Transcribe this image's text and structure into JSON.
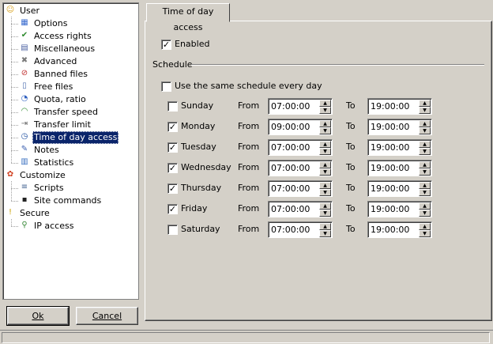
{
  "tree": {
    "items": [
      {
        "label": "User",
        "icon": "user-icon",
        "level": 0
      },
      {
        "label": "Options",
        "icon": "options-icon",
        "level": 1
      },
      {
        "label": "Access rights",
        "icon": "access-rights-icon",
        "level": 1
      },
      {
        "label": "Miscellaneous",
        "icon": "miscellaneous-icon",
        "level": 1
      },
      {
        "label": "Advanced",
        "icon": "tools-icon",
        "level": 1
      },
      {
        "label": "Banned files",
        "icon": "banned-files-icon",
        "level": 1
      },
      {
        "label": "Free files",
        "icon": "file-icon",
        "level": 1
      },
      {
        "label": "Quota, ratio",
        "icon": "quota-icon",
        "level": 1
      },
      {
        "label": "Transfer speed",
        "icon": "speedometer-icon",
        "level": 1
      },
      {
        "label": "Transfer limit",
        "icon": "limit-icon",
        "level": 1
      },
      {
        "label": "Time of day access",
        "icon": "clock-icon",
        "level": 1,
        "selected": true
      },
      {
        "label": "Notes",
        "icon": "notes-icon",
        "level": 1
      },
      {
        "label": "Statistics",
        "icon": "statistics-icon",
        "level": 1
      },
      {
        "label": "Customize",
        "icon": "customize-icon",
        "level": 0
      },
      {
        "label": "Scripts",
        "icon": "script-icon",
        "level": 1
      },
      {
        "label": "Site commands",
        "icon": "console-icon",
        "level": 1
      },
      {
        "label": "Secure",
        "icon": "secure-icon",
        "level": 0
      },
      {
        "label": "IP access",
        "icon": "ip-access-icon",
        "level": 1
      }
    ]
  },
  "buttons": {
    "ok": "Ok",
    "cancel": "Cancel"
  },
  "tab": {
    "label": "Time of day access"
  },
  "panel": {
    "enabled_label": "Enabled",
    "enabled_checked": true,
    "schedule_label": "Schedule",
    "same_schedule_label": "Use the same schedule every day",
    "same_schedule_checked": false,
    "from_label": "From",
    "to_label": "To",
    "days": [
      {
        "name": "Sunday",
        "checked": false,
        "from": "07:00:00",
        "to": "19:00:00"
      },
      {
        "name": "Monday",
        "checked": true,
        "from": "09:00:00",
        "to": "19:00:00"
      },
      {
        "name": "Tuesday",
        "checked": true,
        "from": "07:00:00",
        "to": "19:00:00"
      },
      {
        "name": "Wednesday",
        "checked": true,
        "from": "07:00:00",
        "to": "19:00:00"
      },
      {
        "name": "Thursday",
        "checked": true,
        "from": "07:00:00",
        "to": "19:00:00"
      },
      {
        "name": "Friday",
        "checked": true,
        "from": "07:00:00",
        "to": "19:00:00"
      },
      {
        "name": "Saturday",
        "checked": false,
        "from": "07:00:00",
        "to": "19:00:00"
      }
    ]
  },
  "colors": {
    "selection": "#0a246a",
    "face": "#d4d0c8"
  }
}
